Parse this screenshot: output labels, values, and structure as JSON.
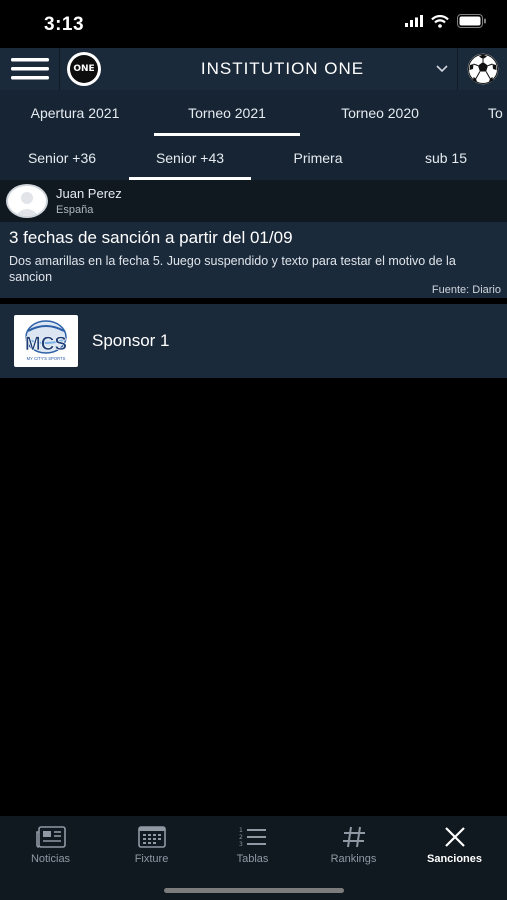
{
  "status_bar": {
    "time": "3:13"
  },
  "header": {
    "logo_text": "ONE",
    "title": "INSTITUTION  ONE"
  },
  "tournament_tabs": [
    {
      "label": "Apertura 2021"
    },
    {
      "label": "Torneo 2021"
    },
    {
      "label": "Torneo 2020"
    },
    {
      "label": "To"
    }
  ],
  "category_tabs": [
    {
      "label": "Senior +36"
    },
    {
      "label": "Senior +43"
    },
    {
      "label": "Primera"
    },
    {
      "label": "sub 15"
    }
  ],
  "sanction": {
    "author": "Juan Perez",
    "country": "España",
    "title": "3 fechas de sanción a partir del 01/09",
    "description": "Dos amarillas en la fecha 5. Juego suspendido y texto para testar el motivo de la sancion",
    "source": "Fuente: Diario"
  },
  "sponsor": {
    "logo_text": "MCS",
    "logo_subtext": "MY CITY'S SPORTS",
    "name": "Sponsor 1"
  },
  "bottom_nav": [
    {
      "label": "Noticias",
      "icon": "newspaper-icon"
    },
    {
      "label": "Fixture",
      "icon": "calendar-icon"
    },
    {
      "label": "Tablas",
      "icon": "numbered-list-icon"
    },
    {
      "label": "Rankings",
      "icon": "hashtag-icon"
    },
    {
      "label": "Sanciones",
      "icon": "close-icon"
    }
  ],
  "colors": {
    "header_bg": "#1b2a3b",
    "tabs_bg": "#162433",
    "page_bg": "#000000",
    "active_indicator": "#ffffff"
  }
}
